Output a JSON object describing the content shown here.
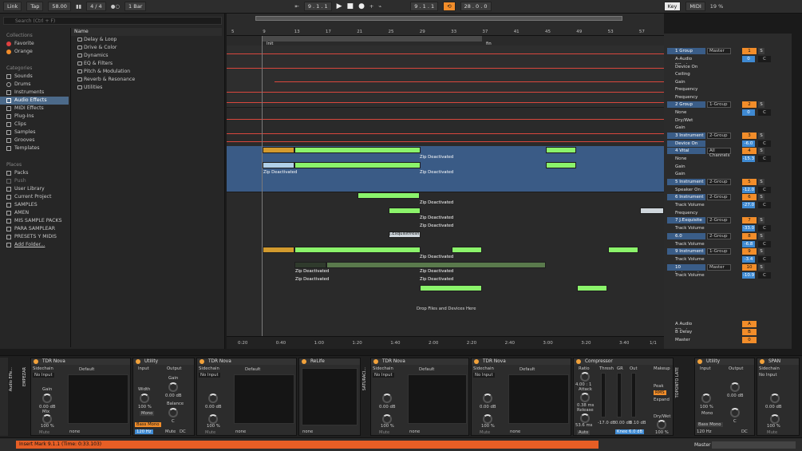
{
  "top": {
    "link": "Link",
    "tap": "Tap",
    "tempo": "58.00",
    "sig": "4 / 4",
    "quant": "1 Bar",
    "pos": "9 . 1 . 1",
    "loop_start": "9 . 1 . 1",
    "loop_len": "28 . 0 . 0",
    "key": "Key",
    "midi": "MIDI",
    "cpu": "19 %"
  },
  "browser": {
    "search_placeholder": "Search (Ctrl + F)",
    "collections_label": "Collections",
    "collections": [
      {
        "label": "Favorite",
        "color": "#e04040"
      },
      {
        "label": "Orange",
        "color": "#f28d2a"
      }
    ],
    "categories_label": "Categories",
    "categories": [
      "Sounds",
      "Drums",
      "Instruments",
      "Audio Effects",
      "MIDI Effects",
      "Plug-Ins",
      "Clips",
      "Samples",
      "Grooves",
      "Templates"
    ],
    "places_label": "Places",
    "places": [
      "Packs",
      "Push",
      "User Library",
      "Current Project",
      "SAMPLES",
      "AMEN",
      "MIS SAMPLE PACKS",
      "PARA SAMPLEAR",
      "PRESETS Y MIDIS",
      "Add Folder..."
    ],
    "name_header": "Name",
    "items": [
      "Delay & Loop",
      "Drive & Color",
      "Dynamics",
      "EQ & Filters",
      "Pitch & Modulation",
      "Reverb & Resonance",
      "Utilities"
    ]
  },
  "arrangement": {
    "bars": [
      "5",
      "9",
      "13",
      "17",
      "21",
      "25",
      "29",
      "33",
      "37",
      "41",
      "45",
      "49",
      "53",
      "57"
    ],
    "locators": [
      "Init",
      "fin"
    ],
    "times": [
      "0:20",
      "0:40",
      "1:00",
      "1:20",
      "1:40",
      "2:00",
      "2:20",
      "2:40",
      "3:00",
      "3:20",
      "3:40"
    ],
    "zoom": "1/1",
    "drop_hint": "Drop Files and Devices Here",
    "clip_deactivated": "Zip Deactivated",
    "clip_named": "J.Exquisitfresh"
  },
  "mixer": {
    "tracks": [
      {
        "name": "1 Group",
        "route": "Master",
        "num": "1",
        "vol": "0",
        "pan": "C",
        "extra": "-18.0",
        "extra2": "-inf"
      },
      {
        "name": "A-Audio Effect",
        "route": "",
        "param": true
      },
      {
        "name": "Device On",
        "param": true
      },
      {
        "name": "Ceiling",
        "param": true
      },
      {
        "name": "Gain",
        "param": true
      },
      {
        "name": "Frequency",
        "param": true
      },
      {
        "name": "Frequency",
        "param": true
      },
      {
        "name": "2 Group",
        "route": "1-Group",
        "num": "2",
        "vol": "0",
        "pan": "C",
        "extra": "-inf",
        "extra2": "-inf"
      },
      {
        "name": "None",
        "param": true
      },
      {
        "name": "Dry/Wet",
        "param": true
      },
      {
        "name": "Gain",
        "param": true
      },
      {
        "name": "3 Instrument",
        "route": "2-Group",
        "num": "3",
        "vol": "-6.0",
        "pan": "C",
        "selected": true
      },
      {
        "name": "Device On",
        "param": true,
        "blue": true
      },
      {
        "name": "4 Vital",
        "route": "All Channels",
        "num": "4",
        "vol": "-15.3",
        "pan": "C",
        "selected": true
      },
      {
        "name": "None",
        "param": true
      },
      {
        "name": "Gain",
        "param": true
      },
      {
        "name": "Gain",
        "param": true
      },
      {
        "name": "5 Instrument",
        "route": "2-Group",
        "num": "5",
        "vol": "-12.0",
        "pan": "C"
      },
      {
        "name": "Speaker On",
        "param": true
      },
      {
        "name": "6 Instrument",
        "route": "2-Group",
        "num": "6",
        "vol": "-27.0",
        "pan": "C"
      },
      {
        "name": "Track Volume",
        "param": true
      },
      {
        "name": "Frequency",
        "param": true
      },
      {
        "name": "7 J.Exquisite",
        "route": "2-Group",
        "num": "7",
        "vol": "-33.0",
        "pan": "C"
      },
      {
        "name": "Track Volume",
        "param": true
      },
      {
        "name": "6.0",
        "route": "2-Group",
        "num": "8",
        "vol": "-6.8",
        "pan": "C"
      },
      {
        "name": "Track Volume",
        "param": true
      },
      {
        "name": "9 Instrument",
        "route": "1-Group",
        "num": "9",
        "vol": "-3.4",
        "pan": "C"
      },
      {
        "name": "Track Volume",
        "param": true
      },
      {
        "name": "10 Instrument",
        "route": "Master",
        "num": "10",
        "vol": "-10.9",
        "pan": "C"
      },
      {
        "name": "Track Volume",
        "param": true
      }
    ],
    "returns": [
      {
        "name": "A Audio Effect",
        "num": "A",
        "tag": "Post"
      },
      {
        "name": "B Delay",
        "num": "B",
        "tag": "Post"
      },
      {
        "name": "Master",
        "route": "1/2",
        "num": "0",
        "pan": "C"
      }
    ]
  },
  "devices": [
    {
      "name": "TDR Nova",
      "left": "Sidechain",
      "sub": "No Input",
      "preset": "Default",
      "gain": "0.00 dB",
      "mix": "100 %",
      "mute": "Mute",
      "io": "none"
    },
    {
      "name": "Utility",
      "input": "Input",
      "output": "Output",
      "width": "100 %",
      "mono": "Mono",
      "bass": "Bass Mono",
      "hz": "120 Hz",
      "gain": "0.00 dB",
      "balance": "C",
      "dc": "DC"
    },
    {
      "name": "TDR Nova",
      "left": "Sidechain",
      "sub": "No Input",
      "preset": "Default",
      "gain": "0.00 dB",
      "mix": "100 %",
      "mute": "Mute",
      "io": "none"
    },
    {
      "name": "ReLife",
      "preset": "",
      "io": "none"
    },
    {
      "name": "TDR Nova",
      "left": "Sidechain",
      "sub": "No Input",
      "preset": "Default",
      "gain": "0.00 dB",
      "mix": "100 %",
      "mute": "Mute",
      "io": "none"
    },
    {
      "name": "TDR Nova",
      "left": "Sidechain",
      "sub": "No Input",
      "preset": "Default",
      "gain": "0.00 dB",
      "mix": "100 %",
      "mute": "Mute",
      "io": "none"
    },
    {
      "name": "Compressor",
      "ratio": "4.00 : 1",
      "attack": "0.38 ms",
      "release": "53.6 ms",
      "thresh": "-17.0 dB",
      "gr": "0.00 dB",
      "out": "0.10 dB",
      "knee": "Knee 6.0 dB",
      "peak": "Peak",
      "rms": "RMS",
      "expand": "Expand",
      "drywet": "100 %",
      "auto": "Auto",
      "makeup": "Makeup"
    },
    {
      "name": "Utility",
      "input": "Input",
      "output": "Output",
      "width": "100 %",
      "mono": "Mono",
      "bass": "Bass Mono",
      "hz": "120 Hz",
      "gain": "0.00 dB",
      "balance": "C",
      "dc": "DC"
    },
    {
      "name": "SPAN",
      "left": "Sidechain",
      "sub": "No Input",
      "gain": "0.00 dB",
      "mix": "100 %",
      "mute": "Mute"
    }
  ],
  "rack_labels": [
    "Audio Effe...",
    "EMPEZAR",
    "SATURACI...",
    "TOPONTO LATE"
  ],
  "status": {
    "message": "Insert Mark 9.1.1 (Time: 0:33.103)",
    "master": "Master"
  }
}
